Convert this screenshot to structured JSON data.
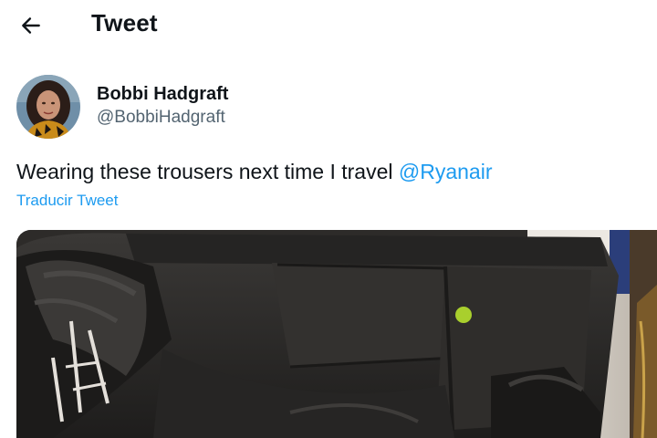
{
  "header": {
    "back_icon": "arrow-left-icon",
    "title": "Tweet"
  },
  "tweet": {
    "author": {
      "display_name": "Bobbi Hadgraft",
      "handle": "@BobbiHadgraft",
      "avatar_icon": "profile-photo"
    },
    "text": "Wearing these trousers next time I travel ",
    "mention": "@Ryanair",
    "translate_label": "Traducir Tweet",
    "media_icon": "photo-black-cargo-trousers"
  },
  "colors": {
    "link": "#1d9bf0",
    "text": "#0f1419",
    "secondary": "#536471",
    "background": "#ffffff"
  }
}
